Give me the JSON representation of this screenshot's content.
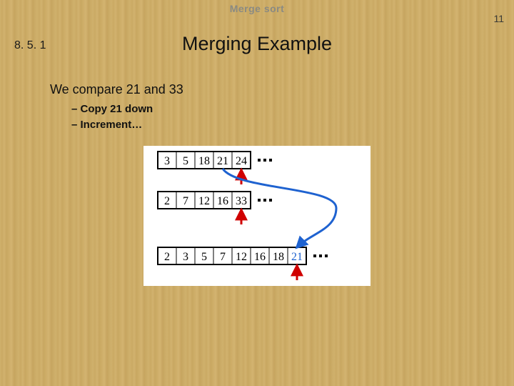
{
  "header": "Merge sort",
  "page_number": "11",
  "section_number": "8. 5. 1",
  "title": "Merging Example",
  "body_line": "We compare 21 and 33",
  "bullets": [
    "Copy 21 down",
    "Increment…"
  ],
  "diagram": {
    "row1": {
      "values": [
        "3",
        "5",
        "18",
        "21",
        "24"
      ],
      "pointer_index": 4,
      "ellipsis": true
    },
    "row2": {
      "values": [
        "2",
        "7",
        "12",
        "16",
        "33"
      ],
      "pointer_index": 4,
      "ellipsis": true
    },
    "row_out": {
      "values": [
        "2",
        "3",
        "5",
        "7",
        "12",
        "16",
        "18",
        "21"
      ],
      "pointer_index": 7,
      "ellipsis": true,
      "highlight_index": 7
    },
    "move_arrow": {
      "from_row": 1,
      "from_index": 3
    }
  }
}
